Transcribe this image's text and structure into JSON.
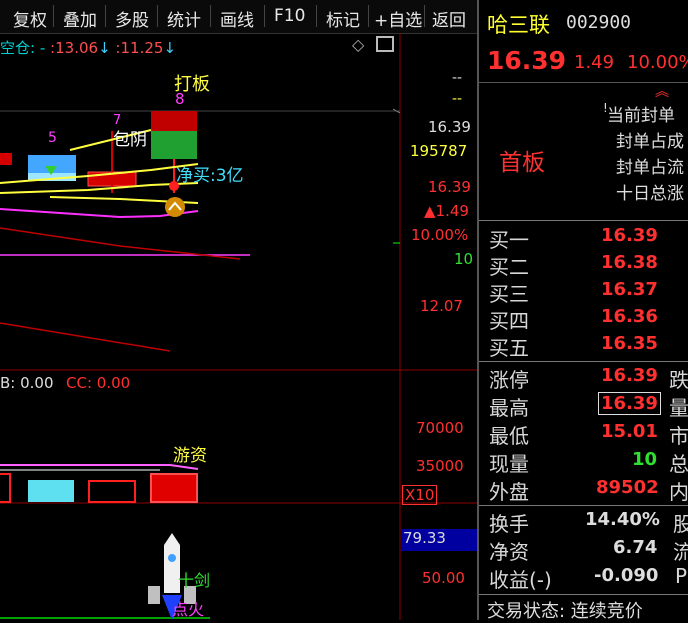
{
  "menu": [
    "复权",
    "叠加",
    "多股",
    "统计",
    "画线",
    "F10",
    "标记",
    "+自选",
    "返回"
  ],
  "main": {
    "ma_prefix": "空仓:",
    "ma_dash": "-",
    "ma_a_prefix": ":",
    "ma_a_value": "13.06",
    "ma_a_arrow": "↓",
    "ma_b_prefix": ":",
    "ma_b_value": "11.25",
    "ma_b_arrow": "↓",
    "label_daban": "打板",
    "label_daban_num": "8",
    "label_baoyin": "包阴",
    "label_baoyin_num": "7",
    "label_net_buy": "净买:3亿",
    "label_num5": "5"
  },
  "price_axis": {
    "dash1": "--",
    "dash2": "--",
    "price": "16.39",
    "volume": "195787",
    "last": "16.39",
    "change": "▲1.49",
    "pct": "10.00%",
    "ten": "10",
    "low": "12.07"
  },
  "indicator": {
    "b_label": "B: 0.00",
    "cc_label": "CC: 0.00",
    "label_youzi": "游资",
    "axis_70000": "70000",
    "axis_35000": "35000",
    "x10": "X10"
  },
  "lower": {
    "axis_value": "79.33",
    "axis_50": "50.00",
    "label_shijian": "十剑",
    "label_dianhuo": "点火"
  },
  "quote": {
    "name": "哈三联",
    "code": "002900",
    "price": "16.39",
    "change": "1.49",
    "pct": "10.00%",
    "board": "首板",
    "notes": [
      "当前封单",
      "封单占成",
      "封单占流",
      "十日总涨"
    ],
    "bids": [
      {
        "label": "买一",
        "value": "16.39"
      },
      {
        "label": "买二",
        "value": "16.38"
      },
      {
        "label": "买三",
        "value": "16.37"
      },
      {
        "label": "买四",
        "value": "16.36"
      },
      {
        "label": "买五",
        "value": "16.35"
      }
    ],
    "stats": [
      {
        "label": "涨停",
        "value": "16.39",
        "right": "跌"
      },
      {
        "label": "最高",
        "value": "16.39",
        "right": "量"
      },
      {
        "label": "最低",
        "value": "15.01",
        "right": "市"
      },
      {
        "label": "现量",
        "value": "10",
        "right": "总"
      },
      {
        "label": "外盘",
        "value": "89502",
        "right": "内"
      }
    ],
    "stats2": [
      {
        "label": "换手",
        "value": "14.40%",
        "right": "股"
      },
      {
        "label": "净资",
        "value": "6.74",
        "right": "流"
      },
      {
        "label": "收益(-)",
        "value": "-0.090",
        "right": "P"
      }
    ],
    "status": "交易状态: 连续竞价"
  }
}
